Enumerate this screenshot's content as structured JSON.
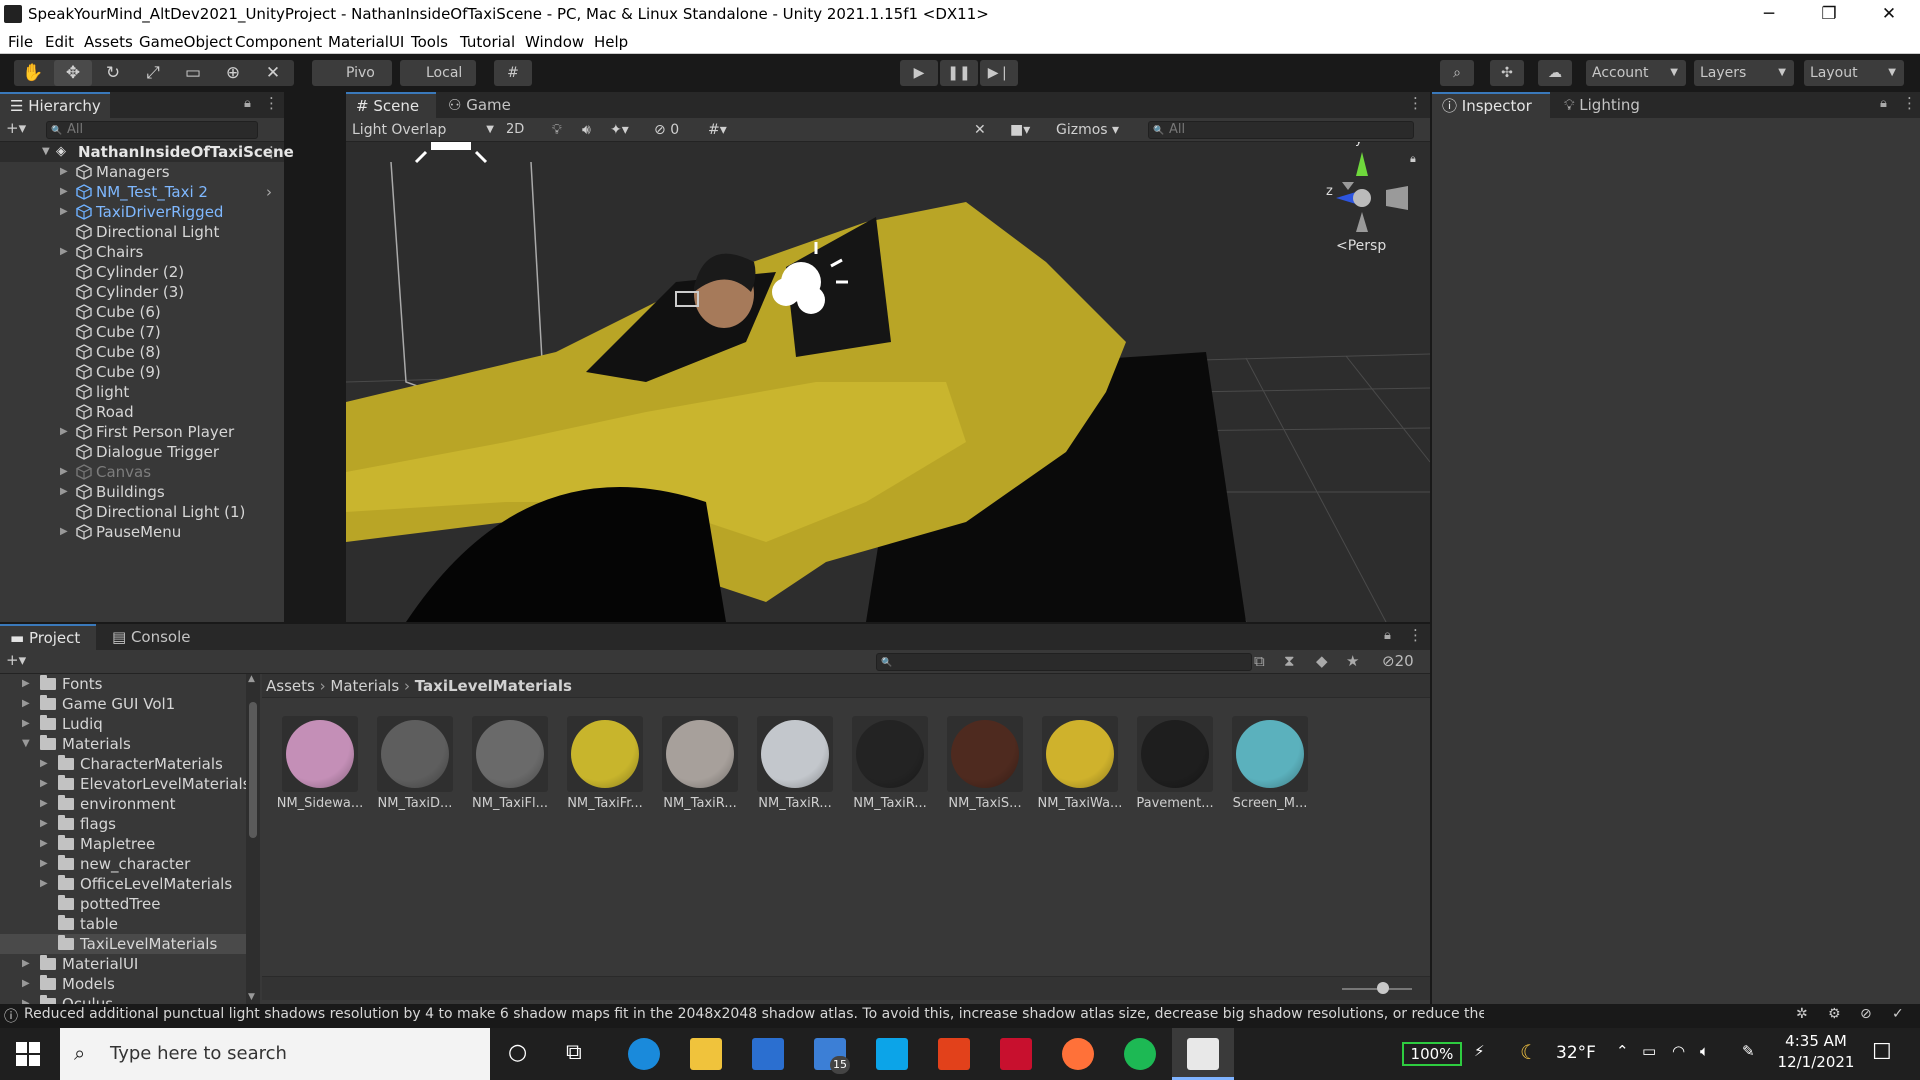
{
  "window": {
    "title": "SpeakYourMind_AltDev2021_UnityProject - NathanInsideOfTaxiScene - PC, Mac & Linux Standalone - Unity 2021.1.15f1 <DX11>",
    "minimize": "─",
    "restore": "❐",
    "close": "✕"
  },
  "menu": [
    "File",
    "Edit",
    "Assets",
    "GameObject",
    "Component",
    "MaterialUI",
    "Tools",
    "Tutorial",
    "Window",
    "Help"
  ],
  "toolbar": {
    "pivot_label": "Pivo",
    "local_label": "Local",
    "account_label": "Account",
    "layers_label": "Layers",
    "layout_label": "Layout"
  },
  "hierarchy": {
    "tab_label": "Hierarchy",
    "search_placeholder": "All",
    "scene_name": "NathanInsideOfTaxiScene",
    "items": [
      {
        "label": "Managers",
        "expandable": true,
        "kind": "normal"
      },
      {
        "label": "NM_Test_Taxi 2",
        "expandable": true,
        "kind": "prefab"
      },
      {
        "label": "TaxiDriverRigged",
        "expandable": true,
        "kind": "prefab"
      },
      {
        "label": "Directional Light",
        "expandable": false,
        "kind": "normal"
      },
      {
        "label": "Chairs",
        "expandable": true,
        "kind": "normal"
      },
      {
        "label": "Cylinder (2)",
        "expandable": false,
        "kind": "normal"
      },
      {
        "label": "Cylinder (3)",
        "expandable": false,
        "kind": "normal"
      },
      {
        "label": "Cube (6)",
        "expandable": false,
        "kind": "normal"
      },
      {
        "label": "Cube (7)",
        "expandable": false,
        "kind": "normal"
      },
      {
        "label": "Cube (8)",
        "expandable": false,
        "kind": "normal"
      },
      {
        "label": "Cube (9)",
        "expandable": false,
        "kind": "normal"
      },
      {
        "label": "light",
        "expandable": false,
        "kind": "normal"
      },
      {
        "label": "Road",
        "expandable": false,
        "kind": "normal"
      },
      {
        "label": "First Person Player",
        "expandable": true,
        "kind": "normal"
      },
      {
        "label": "Dialogue Trigger",
        "expandable": false,
        "kind": "normal"
      },
      {
        "label": "Canvas",
        "expandable": true,
        "kind": "dim"
      },
      {
        "label": "Buildings",
        "expandable": true,
        "kind": "normal"
      },
      {
        "label": "Directional Light (1)",
        "expandable": false,
        "kind": "normal"
      },
      {
        "label": "PauseMenu",
        "expandable": true,
        "kind": "normal"
      }
    ]
  },
  "scene": {
    "tabs": [
      "Scene",
      "Game"
    ],
    "draw_mode": "Light Overlap",
    "mode_2d": "2D",
    "hidden_count": "0",
    "gizmos_label": "Gizmos",
    "search_placeholder": "All",
    "persp_label": "Persp",
    "axis_y": "y",
    "axis_z": "z"
  },
  "inspector": {
    "tabs": [
      "Inspector",
      "Lighting"
    ]
  },
  "project": {
    "tabs": [
      "Project",
      "Console"
    ],
    "folders": [
      {
        "label": "Fonts",
        "depth": 0,
        "expandable": true,
        "selected": false
      },
      {
        "label": "Game GUI Vol1",
        "depth": 0,
        "expandable": true,
        "selected": false
      },
      {
        "label": "Ludiq",
        "depth": 0,
        "expandable": true,
        "selected": false
      },
      {
        "label": "Materials",
        "depth": 0,
        "expandable": true,
        "selected": false
      },
      {
        "label": "CharacterMaterials",
        "depth": 1,
        "expandable": true,
        "selected": false
      },
      {
        "label": "ElevatorLevelMaterials",
        "depth": 1,
        "expandable": true,
        "selected": false
      },
      {
        "label": "environment",
        "depth": 1,
        "expandable": true,
        "selected": false
      },
      {
        "label": "flags",
        "depth": 1,
        "expandable": true,
        "selected": false
      },
      {
        "label": "Mapletree",
        "depth": 1,
        "expandable": true,
        "selected": false
      },
      {
        "label": "new_character",
        "depth": 1,
        "expandable": true,
        "selected": false
      },
      {
        "label": "OfficeLevelMaterials",
        "depth": 1,
        "expandable": true,
        "selected": false
      },
      {
        "label": "pottedTree",
        "depth": 1,
        "expandable": false,
        "selected": false
      },
      {
        "label": "table",
        "depth": 1,
        "expandable": false,
        "selected": false
      },
      {
        "label": "TaxiLevelMaterials",
        "depth": 1,
        "expandable": false,
        "selected": true
      },
      {
        "label": "MaterialUI",
        "depth": 0,
        "expandable": true,
        "selected": false
      },
      {
        "label": "Models",
        "depth": 0,
        "expandable": true,
        "selected": false
      },
      {
        "label": "Oculus",
        "depth": 0,
        "expandable": true,
        "selected": false
      }
    ],
    "breadcrumb": [
      "Assets",
      "Materials",
      "TaxiLevelMaterials"
    ],
    "hidden_count": "20",
    "assets": [
      {
        "name": "NM_Sidewa...",
        "color": "#c48fb7"
      },
      {
        "name": "NM_TaxiD...",
        "color": "#5e5e5e"
      },
      {
        "name": "NM_TaxiFl...",
        "color": "#6a6a6a"
      },
      {
        "name": "NM_TaxiFr...",
        "color": "#c8b52c"
      },
      {
        "name": "NM_TaxiR...",
        "color": "#a7a09b"
      },
      {
        "name": "NM_TaxiR...",
        "color": "#c3c7cc"
      },
      {
        "name": "NM_TaxiR...",
        "color": "#232323"
      },
      {
        "name": "NM_TaxiS...",
        "color": "#4e2a1f"
      },
      {
        "name": "NM_TaxiWa...",
        "color": "#cfb22c"
      },
      {
        "name": "Pavement...",
        "color": "#1e1e1e"
      },
      {
        "name": "Screen_M...",
        "color": "#5bb1bd"
      }
    ]
  },
  "status": {
    "message": "Reduced additional punctual light shadows resolution by 4 to make 6 shadow maps fit in the 2048x2048 shadow atlas. To avoid this, increase shadow atlas size, decrease big shadow resolutions, or reduce the number of shadow maps acti"
  },
  "taskbar": {
    "search_placeholder": "Type here to search",
    "mail_badge": "15",
    "battery": "100%",
    "temperature": "32°F",
    "time": "4:35 AM",
    "date": "12/1/2021"
  }
}
